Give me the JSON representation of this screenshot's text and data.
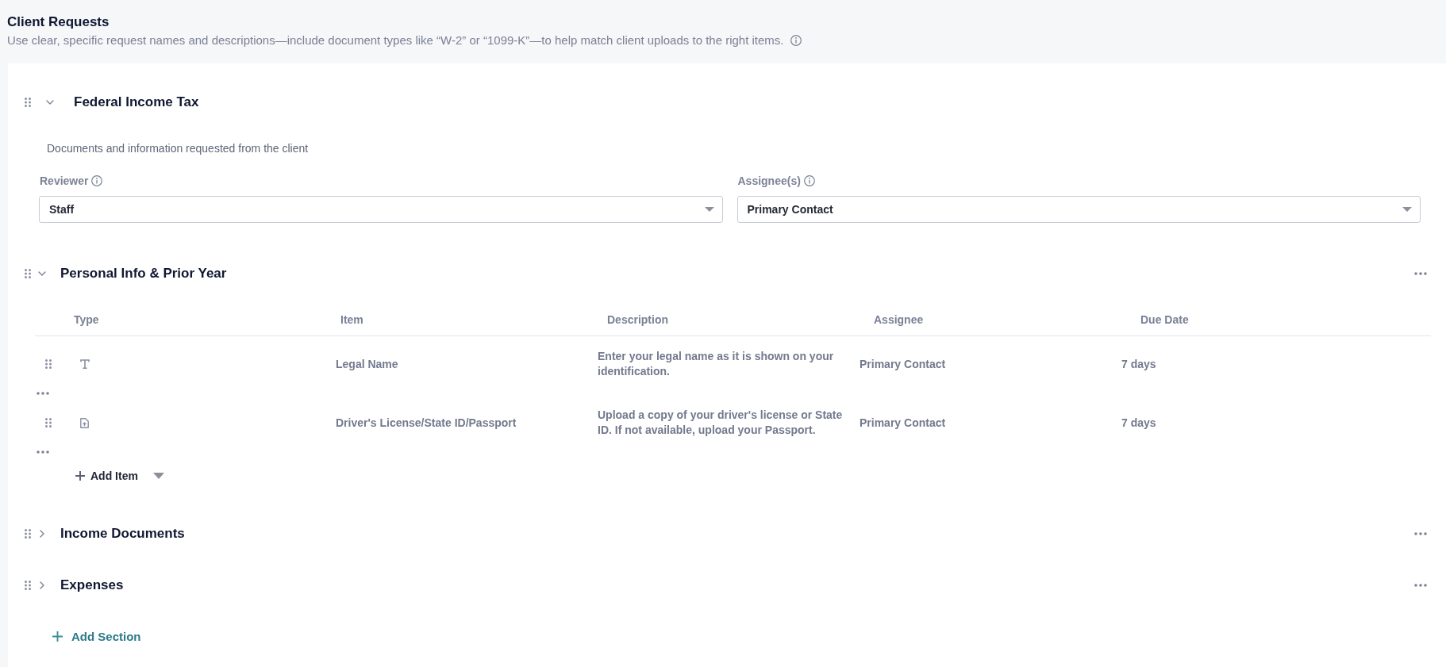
{
  "header": {
    "title": "Client Requests",
    "description": "Use clear, specific request names and descriptions—include document types like “W-2” or “1099-K”—to help match client uploads to the right items."
  },
  "section": {
    "title": "Federal Income Tax",
    "expanded": true,
    "description": "Documents and information requested from the client",
    "fields": [
      {
        "label": "Reviewer",
        "value": "Staff"
      },
      {
        "label": "Assignee(s)",
        "value": "Primary Contact"
      }
    ]
  },
  "groups": [
    {
      "title": "Personal Info & Prior Year",
      "expanded": true,
      "columns": [
        "Type",
        "Item",
        "Description",
        "Assignee",
        "Due Date"
      ],
      "rows": [
        {
          "kind": "text",
          "item": "Legal Name",
          "description": "Enter your legal name as it is shown on your identification.",
          "assignee": "Primary Contact",
          "due_date": "7 days"
        },
        {
          "kind": "upload",
          "item": "Driver's License/State ID/Passport",
          "description": "Upload a copy of your driver's license or State ID. If not available, upload your Passport.",
          "assignee": "Primary Contact",
          "due_date": "7 days"
        }
      ],
      "add_item": "Add Item"
    },
    {
      "title": "Income Documents",
      "expanded": false
    },
    {
      "title": "Expenses",
      "expanded": false
    }
  ],
  "add_section": "Add Section"
}
